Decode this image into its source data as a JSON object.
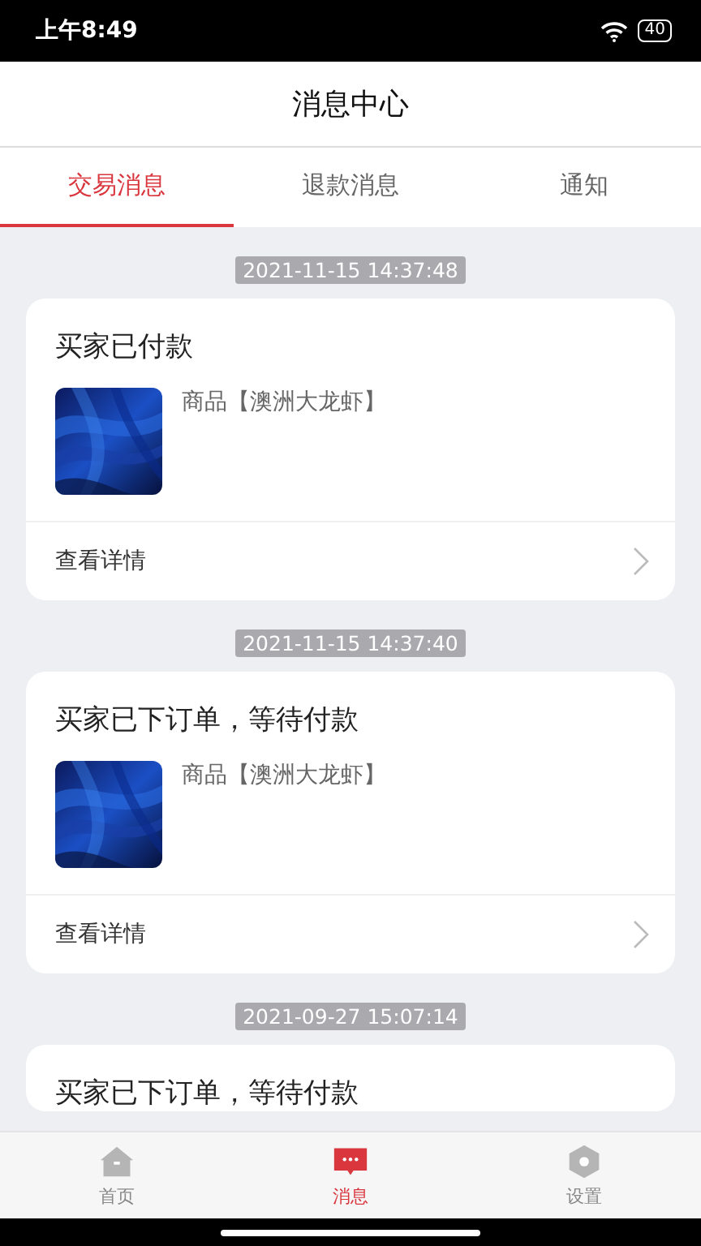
{
  "status_bar": {
    "time": "上午8:49",
    "battery": "40"
  },
  "header": {
    "title": "消息中心"
  },
  "tabs": [
    {
      "label": "交易消息",
      "selected": true
    },
    {
      "label": "退款消息",
      "selected": false
    },
    {
      "label": "通知",
      "selected": false
    }
  ],
  "messages": [
    {
      "time": "2021-11-15 14:37:48",
      "title": "买家已付款",
      "product": "商品【澳洲大龙虾】",
      "link": "查看详情"
    },
    {
      "time": "2021-11-15 14:37:40",
      "title": "买家已下订单，等待付款",
      "product": "商品【澳洲大龙虾】",
      "link": "查看详情"
    },
    {
      "time": "2021-09-27 15:07:14",
      "title": "买家已下订单，等待付款"
    }
  ],
  "bottom_nav": [
    {
      "label": "首页",
      "kind": "home",
      "selected": false
    },
    {
      "label": "消息",
      "kind": "message",
      "selected": true
    },
    {
      "label": "设置",
      "kind": "settings",
      "selected": false
    }
  ]
}
